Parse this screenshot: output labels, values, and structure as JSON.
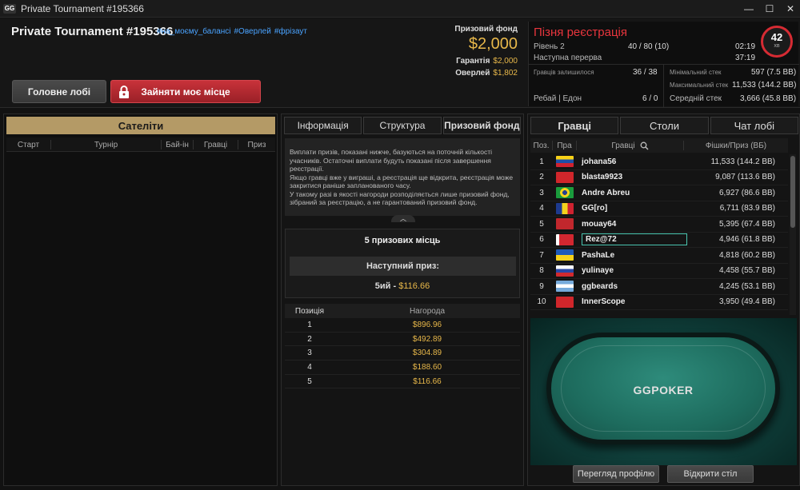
{
  "window": {
    "title": "Private Tournament #195366",
    "minimize": "—",
    "maximize": "☐",
    "close": "✕"
  },
  "header": {
    "title": "Private Tournament #195366",
    "tags": [
      "#на_моєму_балансі",
      "#Оверлей",
      "#фрізаут"
    ],
    "lobby_button": "Головне лобі",
    "seat_button": "Зайняти моє місце",
    "prize_fund_label": "Призовий фонд",
    "prize_fund": "$2,000",
    "guarantee_label": "Гарантія",
    "guarantee": "$2,000",
    "overlay_label": "Оверлей",
    "overlay": "$1,802"
  },
  "late_reg": {
    "title": "Пізня реєстрація",
    "level_label": "Рівень 2",
    "level_value": "40 / 80 (10)",
    "level_time": "02:19",
    "break_label": "Наступна перерва",
    "break_time": "37:19",
    "timer_value": "42",
    "timer_unit": "хв",
    "players_left_label": "Гравців залишилося",
    "players_left": "36 / 38",
    "rebuy_label": "Ребай | Едон",
    "rebuy_value": "6 / 0",
    "min_stack_label": "Мінімальний стек",
    "min_stack": "597 (7.5 BB)",
    "max_stack_label": "Максимальний стек",
    "max_stack": "11,533 (144.2 BB)",
    "avg_stack_label": "Середній стек",
    "avg_stack": "3,666 (45.8 BB)"
  },
  "satellites": {
    "title": "Сателіти",
    "columns": [
      "Старт",
      "Турнір",
      "Бай-ін",
      "Гравці",
      "Приз"
    ]
  },
  "middle": {
    "tabs": [
      "Інформація",
      "Структура",
      "Призовий фонд"
    ],
    "active_tab": 2,
    "info_text": "Виплати призів, показані нижче, базуються на поточній кількості учасників. Остаточні виплати будуть показані після завершення реєстрації.\nЯкщо гравці вже у виграші, а реєстрація ще відкрита, реєстрація може закритися раніше запланованого часу.\nУ такому разі в якості нагороди розподіляється лише призовий фонд, зібраний за реєстрацію, а не гарантований призовий фонд.",
    "places_title": "5 призових місць",
    "next_prize_label": "Наступний приз:",
    "next_prize_place": "5ий",
    "next_prize_sep": "-",
    "next_prize_amount": "$116.66",
    "table_headers": [
      "Позиція",
      "Нагорода"
    ],
    "prizes": [
      {
        "pos": "1",
        "amount": "$896.96"
      },
      {
        "pos": "2",
        "amount": "$492.89"
      },
      {
        "pos": "3",
        "amount": "$304.89"
      },
      {
        "pos": "4",
        "amount": "$188.60"
      },
      {
        "pos": "5",
        "amount": "$116.66"
      }
    ]
  },
  "right": {
    "tabs": [
      "Гравці",
      "Столи",
      "Чат лобі"
    ],
    "active_tab": 0,
    "columns": [
      "Поз.",
      "Пра",
      "Гравці",
      "Фішки/Приз (ВБ)"
    ],
    "players": [
      {
        "rank": "1",
        "flag": "venezuela",
        "name": "johana56",
        "chips": "11,533 (144.2 BB)"
      },
      {
        "rank": "2",
        "flag": "albania",
        "name": "blasta9923",
        "chips": "9,087 (113.6 BB)"
      },
      {
        "rank": "3",
        "flag": "brazil",
        "name": "Andre Abreu",
        "chips": "6,927 (86.6 BB)"
      },
      {
        "rank": "4",
        "flag": "romania",
        "name": "GG[ro]",
        "chips": "6,711 (83.9 BB)"
      },
      {
        "rank": "5",
        "flag": "morocco",
        "name": "mouay64",
        "chips": "5,395 (67.4 BB)"
      },
      {
        "rank": "6",
        "flag": "belarus",
        "name": "Rez@72",
        "chips": "4,946 (61.8 BB)"
      },
      {
        "rank": "7",
        "flag": "ukraine",
        "name": "PashaLe",
        "chips": "4,818 (60.2 BB)"
      },
      {
        "rank": "8",
        "flag": "russia",
        "name": "yulinaye",
        "chips": "4,458 (55.7 BB)"
      },
      {
        "rank": "9",
        "flag": "argentina",
        "name": "ggbeards",
        "chips": "4,245 (53.1 BB)"
      },
      {
        "rank": "10",
        "flag": "albania",
        "name": "InnerScope",
        "chips": "3,950 (49.4 BB)"
      }
    ],
    "highlighted_rank": "6",
    "table_logo": "GGPOKER",
    "profile_button": "Перегляд профілю",
    "open_table_button": "Відкрити стіл"
  },
  "colors": {
    "accent_gold": "#b49a66",
    "money": "#e8b84a",
    "late_reg_red": "#e8353d",
    "tag_blue": "#4aa3ff"
  }
}
